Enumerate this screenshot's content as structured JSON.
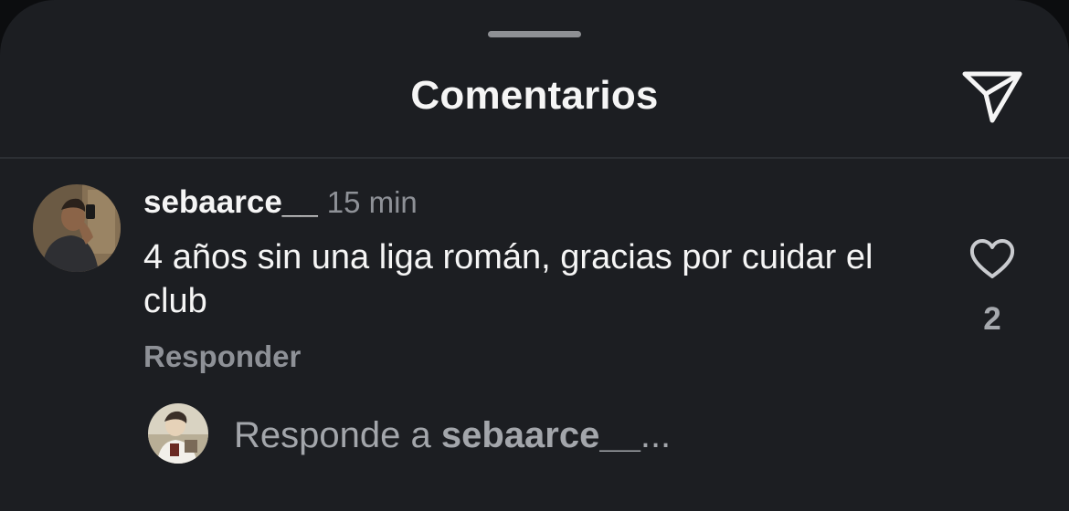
{
  "header": {
    "title": "Comentarios",
    "share_icon": "paper-plane-icon"
  },
  "comment": {
    "username": "sebaarce__",
    "time": "15 min",
    "text": "4 años sin una liga román, gracias por cuidar el club",
    "reply_label": "Responder",
    "like_icon": "heart-outline-icon",
    "like_count": "2"
  },
  "reply_box": {
    "prefix": "Responde a",
    "username": "sebaarce__",
    "suffix": "..."
  },
  "colors": {
    "background": "#1c1e22",
    "primary_text": "#f5f5f5",
    "secondary_text": "#8e9197"
  }
}
